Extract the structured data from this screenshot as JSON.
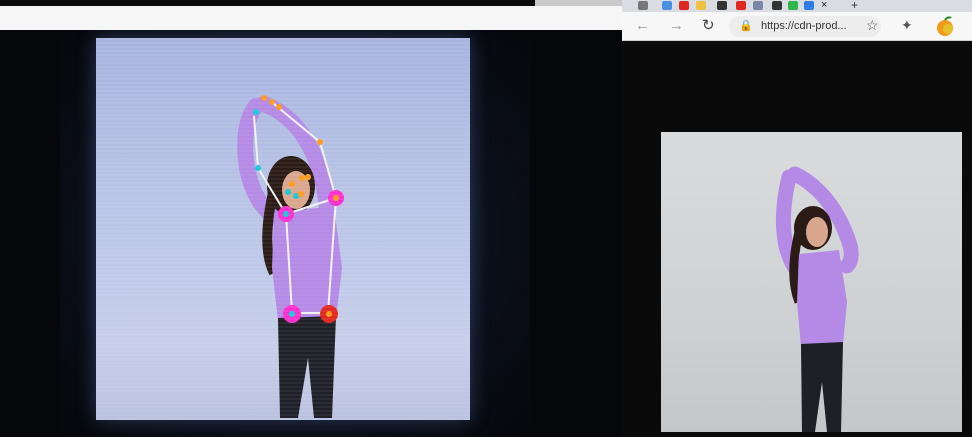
{
  "browser": {
    "tab_close_glyph": "×",
    "tab_new_glyph": "+",
    "url": "https://cdn-prod...",
    "icons": {
      "back": "arrow-left-icon",
      "forward": "arrow-right-icon",
      "reload": "reload-icon",
      "lock": "lock-icon",
      "favorites": "star-add-icon",
      "extensions": "puzzle-icon",
      "profile": "fruit-avatar-icon"
    }
  },
  "colors": {
    "keypoint_magenta": "#ff2fd0",
    "keypoint_red": "#e0281e",
    "keypoint_cyan": "#18c9d9",
    "keypoint_orange": "#ff9a1a",
    "top_shirt": "#b48ae6",
    "pants": "#1e1f27"
  }
}
